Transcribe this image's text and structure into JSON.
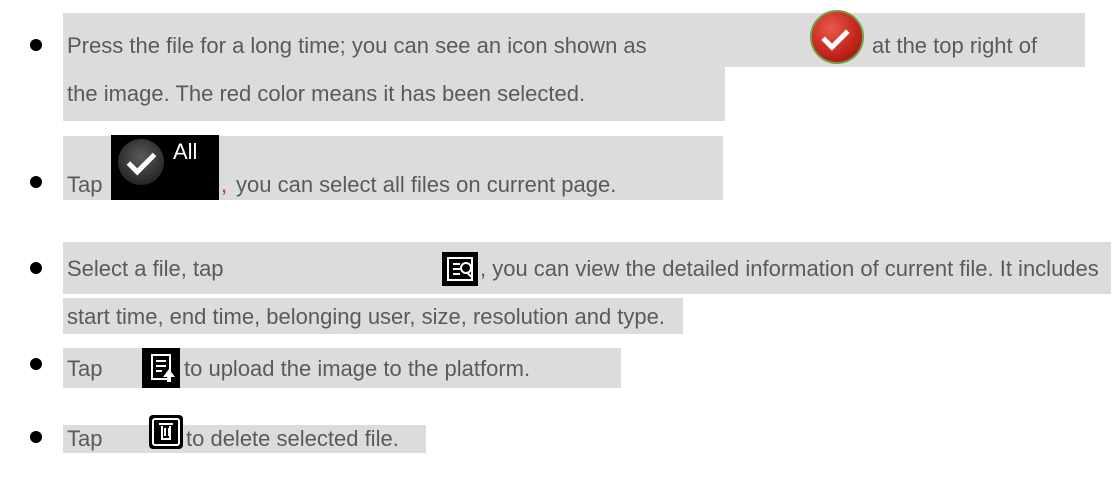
{
  "items": [
    {
      "line1_prefix": "Press the file for a long time; you can see an icon shown as",
      "line1_suffix": "at the top right of",
      "line2": "the image. The red color means it has been selected.",
      "icon": "red-check-circle-icon"
    },
    {
      "prefix": "Tap",
      "button_label": "All",
      "comma": ",",
      "suffix": "you can select all files on current page.",
      "icon": "check-icon"
    },
    {
      "line1_prefix": "Select a file, tap",
      "line1_suffix": ", you can view the detailed information of current file. It includes",
      "line2": "start time, end time, belonging user, size, resolution and type.",
      "icon": "detail-search-icon"
    },
    {
      "prefix": "Tap",
      "suffix": "to upload the image to the platform.",
      "icon": "upload-document-icon"
    },
    {
      "prefix": "Tap",
      "suffix": "to delete selected file.",
      "icon": "trash-icon"
    }
  ],
  "colors": {
    "highlight": "#dcdcdc",
    "text": "#5a5a5a",
    "accent_red": "#e8281c"
  }
}
